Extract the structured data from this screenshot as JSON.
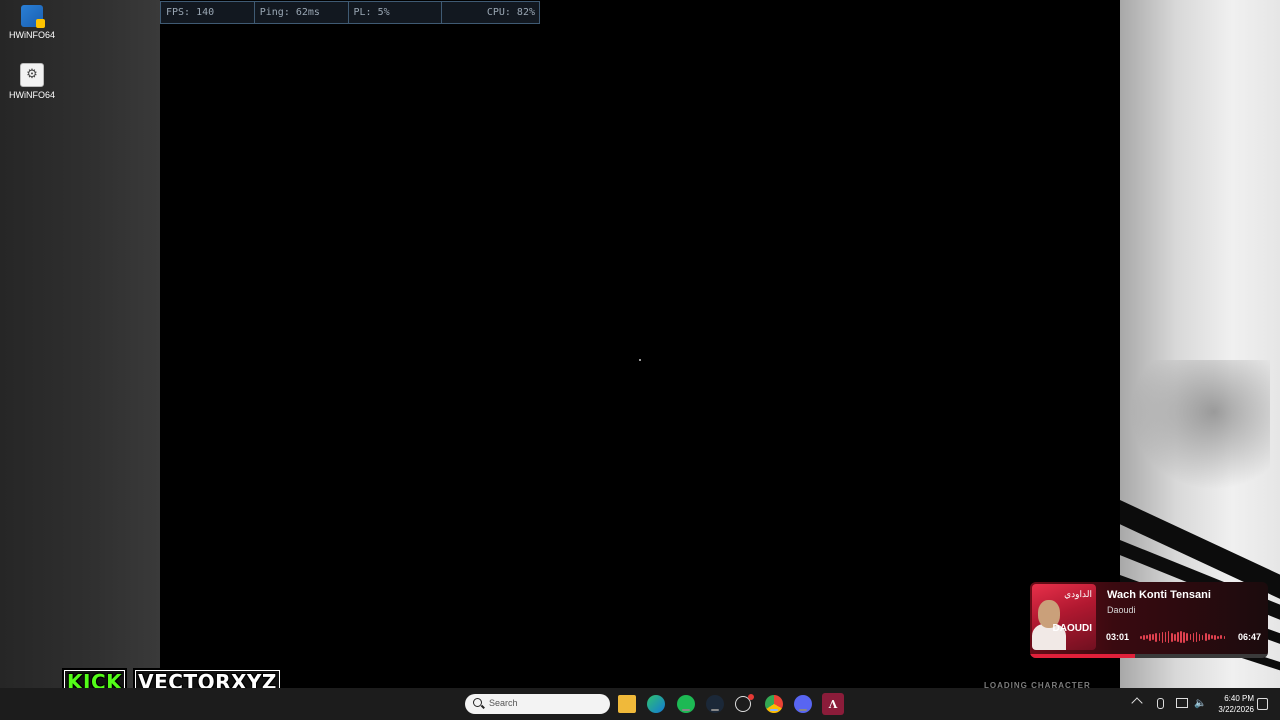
{
  "desktop": {
    "icons": [
      {
        "label": "HWiNFO64"
      },
      {
        "label": "HWiNFO64"
      }
    ]
  },
  "stats_bar": {
    "fps": "FPS: 140",
    "ping": "Ping: 62ms",
    "pl": "PL: 5%",
    "cpu": "CPU: 82%"
  },
  "overlay": {
    "platform_logo": "KICK",
    "channel_name": "VECTORXYZ",
    "loading_text": "LOADING CHARACTER"
  },
  "now_playing": {
    "title": "Wach Konti Tensani",
    "artist": "Daoudi",
    "album_text": "DAOUDI",
    "elapsed": "03:01",
    "duration": "06:47",
    "progress": 0.44,
    "accent_color": "#e0203a"
  },
  "taskbar": {
    "search_placeholder": "Search",
    "pinned": [
      "windows-start",
      "file-explorer",
      "edge",
      "spotify",
      "steam",
      "app-clock",
      "chrome",
      "discord",
      "app-red"
    ],
    "clock_time": "6:40 PM",
    "clock_date": "3/22/2026"
  }
}
